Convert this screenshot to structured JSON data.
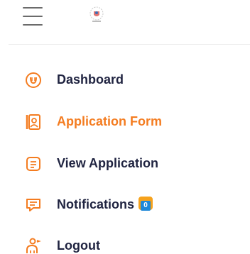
{
  "header": {
    "menu_icon": "hamburger-icon",
    "logo_icon": "crest-logo"
  },
  "menu": {
    "items": [
      {
        "label": "Dashboard",
        "icon": "dashboard-icon",
        "active": false
      },
      {
        "label": "Application Form",
        "icon": "application-form-icon",
        "active": true
      },
      {
        "label": "View Application",
        "icon": "view-application-icon",
        "active": false
      },
      {
        "label": "Notifications",
        "icon": "notifications-icon",
        "active": false,
        "badge": "0"
      },
      {
        "label": "Logout",
        "icon": "logout-icon",
        "active": false
      }
    ]
  },
  "colors": {
    "accent": "#f47c20",
    "text": "#1f2340",
    "badge_outer": "#f6a21c",
    "badge_inner": "#1e88d8"
  }
}
